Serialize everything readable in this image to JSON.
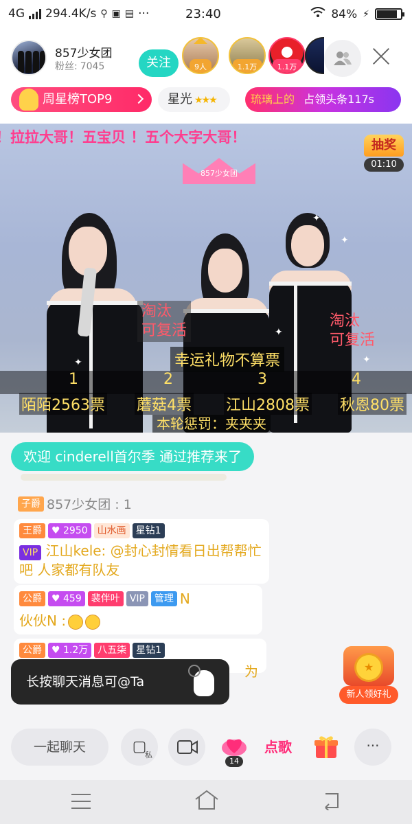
{
  "status_bar": {
    "network": "4G",
    "speed": "294.4K/s",
    "more": "···",
    "time": "23:40",
    "battery": "84%",
    "battery_level": 0.84
  },
  "header": {
    "anchor_name": "857少女团",
    "fans_label": "粉丝:",
    "fans_count": "7045",
    "follow_label": "关注",
    "viewers": [
      {
        "badge": "9人"
      },
      {
        "badge": "1.1万"
      },
      {
        "badge": "1.1万"
      }
    ]
  },
  "rank_strip": {
    "weekly_star": "周星榜TOP9",
    "starlight": "星光",
    "starlight_stars": "★★★",
    "headline_name": "琉璃上的",
    "headline_text": "占领头条117s"
  },
  "video": {
    "marquee": "！拉拉大哥！五宝贝 ！五个大字大哥！",
    "lottery_label": "抽奖",
    "lottery_timer": "01:10",
    "logo_text": "857少女团",
    "sign_left": "淘汰\n可复活",
    "sign_right": "淘汰\n可复活",
    "lucky_text": "幸运礼物不算票",
    "contestants": [
      {
        "num": "1",
        "label": "陌陌2563票"
      },
      {
        "num": "2",
        "label": "蘑菇4票"
      },
      {
        "num": "3",
        "label": "江山2808票"
      },
      {
        "num": "4",
        "label": "秋恩80票"
      }
    ],
    "punish": "本轮惩罚：夹夹夹"
  },
  "chat": {
    "welcome": "欢迎 cinderell首尔季 通过推荐来了",
    "messages": [
      {
        "rank": "子爵",
        "user": "857少女团 : 1"
      },
      {
        "rank": "王爵",
        "dia": "2950",
        "fan": "山水画",
        "star": "星钻1",
        "vip": "VIP",
        "text": "江山kele: @封心封情看日出帮帮忙吧 人家都有队友"
      },
      {
        "rank": "公爵",
        "dia": "459",
        "fan": "裴伴叶",
        "vip2": "VIP",
        "admin": "管理",
        "text": "伙伙N :",
        "trail": "N"
      },
      {
        "rank": "公爵",
        "dia": "1.2万",
        "fan": "八五柒",
        "star": "星钻1",
        "text_tail": "为"
      }
    ],
    "tooltip": "长按聊天消息可@Ta",
    "gift_pack_label": "新人领好礼"
  },
  "toolbar": {
    "chat_label": "一起聊天",
    "private_label": "私",
    "bag_count": "14",
    "song_label": "点歌",
    "more": "···"
  },
  "colors": {
    "accent_teal": "#24d6c3",
    "weekly_pink": "#ff2a68",
    "vote_yellow": "#ffe067"
  }
}
